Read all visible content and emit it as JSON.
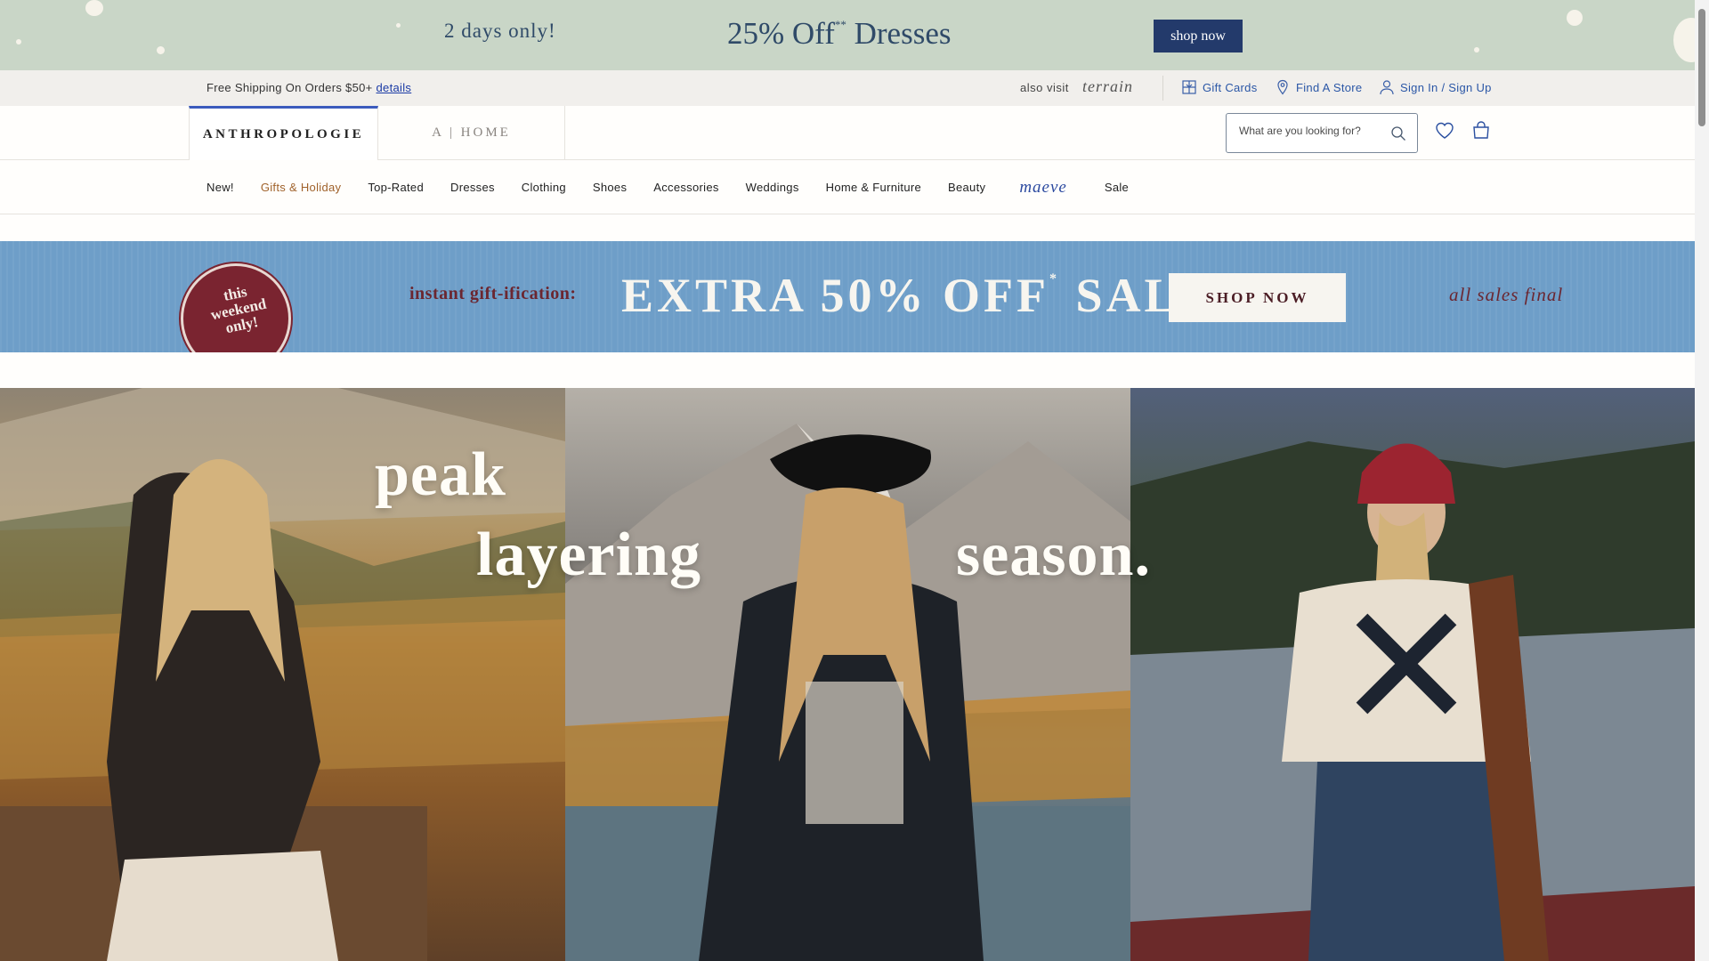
{
  "promo_top": {
    "days": "2 days only!",
    "offer": "25% Off",
    "offer_mark": "**",
    "offer_item": "Dresses",
    "cta": "shop now",
    "bg_color": "#c9d6c7",
    "accent_color": "#233a6b"
  },
  "utility": {
    "shipping_text": "Free Shipping On Orders $50+",
    "details_link": "details",
    "also_visit": "also visit",
    "terrain": "terrain",
    "gift_cards": "Gift Cards",
    "find_store": "Find A Store",
    "sign_in": "Sign In / Sign Up"
  },
  "brand": {
    "anthro": "ANTHROPOLOGIE",
    "home": "A | HOME",
    "search_placeholder": "What are you looking for?"
  },
  "nav": {
    "items": [
      "New!",
      "Gifts & Holiday",
      "Top-Rated",
      "Dresses",
      "Clothing",
      "Shoes",
      "Accessories",
      "Weddings",
      "Home & Furniture",
      "Beauty",
      "maeve",
      "Sale"
    ]
  },
  "sale_banner": {
    "badge": "this weekend only!",
    "instant": "instant gift-ification:",
    "headline": "EXTRA 50% OFF",
    "mark": "*",
    "headline_end": "SALE",
    "cta": "SHOP NOW",
    "final": "all sales final",
    "bg_color": "#6e9ec8",
    "text_accent": "#6b2630"
  },
  "hero": {
    "word1": "peak",
    "word2": "layering",
    "word3": "season."
  }
}
